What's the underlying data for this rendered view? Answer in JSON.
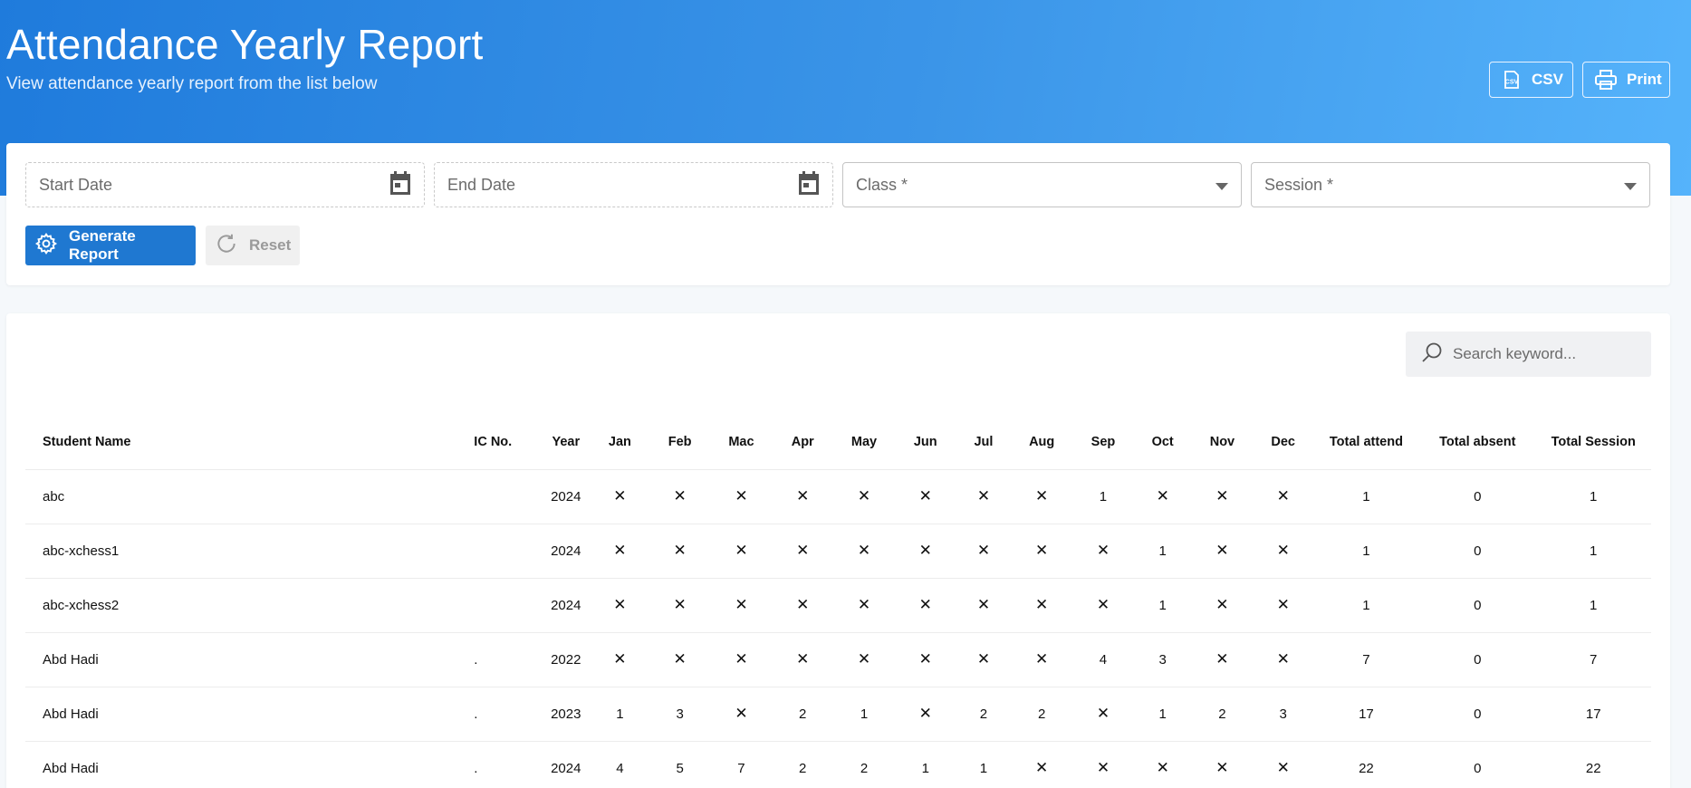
{
  "header": {
    "title": "Attendance Yearly Report",
    "subtitle": "View attendance yearly report from the list below",
    "csv_label": "CSV",
    "print_label": "Print"
  },
  "filters": {
    "start_date_placeholder": "Start Date",
    "end_date_placeholder": "End Date",
    "class_placeholder": "Class *",
    "session_placeholder": "Session *",
    "generate_label": "Generate Report",
    "reset_label": "Reset"
  },
  "search": {
    "placeholder": "Search keyword..."
  },
  "colors": {
    "accent": "#1f78d1",
    "absent_mark": "#e53935"
  },
  "table": {
    "columns": [
      "Student Name",
      "IC No.",
      "Year",
      "Jan",
      "Feb",
      "Mac",
      "Apr",
      "May",
      "Jun",
      "Jul",
      "Aug",
      "Sep",
      "Oct",
      "Nov",
      "Dec",
      "Total attend",
      "Total absent",
      "Total Session"
    ],
    "absent_symbol": "✕",
    "rows": [
      {
        "name": "abc",
        "ic": "",
        "year": "2024",
        "months": [
          "✕",
          "✕",
          "✕",
          "✕",
          "✕",
          "✕",
          "✕",
          "✕",
          "1",
          "✕",
          "✕",
          "✕"
        ],
        "total_attend": "1",
        "total_absent": "0",
        "total_session": "1"
      },
      {
        "name": "abc-xchess1",
        "ic": "",
        "year": "2024",
        "months": [
          "✕",
          "✕",
          "✕",
          "✕",
          "✕",
          "✕",
          "✕",
          "✕",
          "✕",
          "1",
          "✕",
          "✕"
        ],
        "total_attend": "1",
        "total_absent": "0",
        "total_session": "1"
      },
      {
        "name": "abc-xchess2",
        "ic": "",
        "year": "2024",
        "months": [
          "✕",
          "✕",
          "✕",
          "✕",
          "✕",
          "✕",
          "✕",
          "✕",
          "✕",
          "1",
          "✕",
          "✕"
        ],
        "total_attend": "1",
        "total_absent": "0",
        "total_session": "1"
      },
      {
        "name": "Abd Hadi",
        "ic": ".",
        "year": "2022",
        "months": [
          "✕",
          "✕",
          "✕",
          "✕",
          "✕",
          "✕",
          "✕",
          "✕",
          "4",
          "3",
          "✕",
          "✕"
        ],
        "total_attend": "7",
        "total_absent": "0",
        "total_session": "7"
      },
      {
        "name": "Abd Hadi",
        "ic": ".",
        "year": "2023",
        "months": [
          "1",
          "3",
          "✕",
          "2",
          "1",
          "✕",
          "2",
          "2",
          "✕",
          "1",
          "2",
          "3"
        ],
        "total_attend": "17",
        "total_absent": "0",
        "total_session": "17"
      },
      {
        "name": "Abd Hadi",
        "ic": ".",
        "year": "2024",
        "months": [
          "4",
          "5",
          "7",
          "2",
          "2",
          "1",
          "1",
          "✕",
          "✕",
          "✕",
          "✕",
          "✕"
        ],
        "total_attend": "22",
        "total_absent": "0",
        "total_session": "22"
      }
    ]
  }
}
